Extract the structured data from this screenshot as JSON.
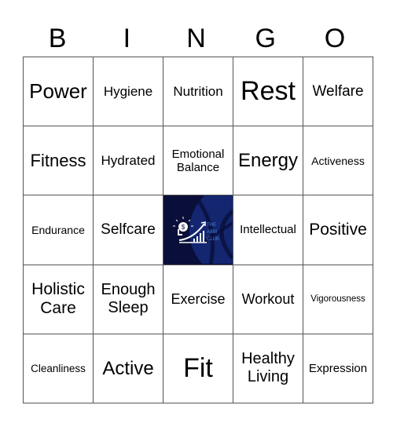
{
  "header": {
    "letters": [
      "B",
      "I",
      "N",
      "G",
      "O"
    ]
  },
  "grid": {
    "rows": [
      [
        "Power",
        "Hygiene",
        "Nutrition",
        "Rest",
        "Welfare"
      ],
      [
        "Fitness",
        "Hydrated",
        "Emotional Balance",
        "Energy",
        "Activeness"
      ],
      [
        "Endurance",
        "Selfcare",
        "",
        "Intellectual",
        "Positive"
      ],
      [
        "Holistic Care",
        "Enough Sleep",
        "Exercise",
        "Workout",
        "Vigorousness"
      ],
      [
        "Cleanliness",
        "Active",
        "Fit",
        "Healthy Living",
        "Expression"
      ]
    ],
    "free_space": {
      "logo_text": [
        "THE",
        "ABM",
        "CLUB"
      ],
      "icon": "head-dollar-growth-chart-icon"
    }
  },
  "colors": {
    "logo_bg": "#0a0f3a",
    "logo_accent": "#4a7fd8",
    "grid_line": "#555555"
  }
}
